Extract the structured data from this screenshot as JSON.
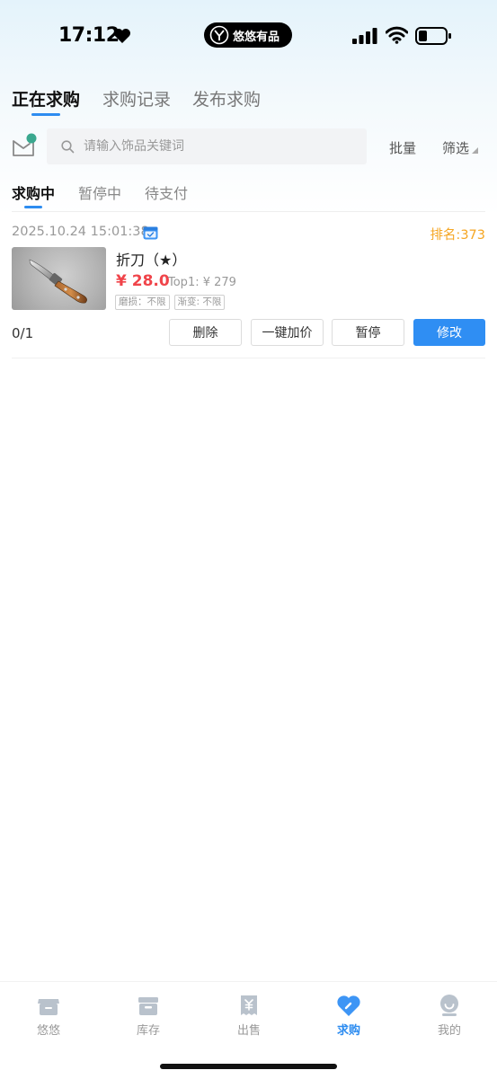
{
  "status_bar": {
    "time": "17:12",
    "app_pill": "悠悠有品"
  },
  "main_tabs": [
    {
      "label": "正在求购",
      "active": true
    },
    {
      "label": "求购记录",
      "active": false
    },
    {
      "label": "发布求购",
      "active": false
    }
  ],
  "search": {
    "placeholder": "请输入饰品关键词",
    "value": ""
  },
  "toolbar": {
    "batch_label": "批量",
    "filter_label": "筛选"
  },
  "sub_tabs": [
    {
      "label": "求购中",
      "active": true
    },
    {
      "label": "暂停中",
      "active": false
    },
    {
      "label": "待支付",
      "active": false
    }
  ],
  "orders": [
    {
      "date": "2025.10.24 15:01:38",
      "rank": "排名:373",
      "name": "折刀（★）",
      "price": "¥ 28.0",
      "top_price": "Top1: ¥ 279",
      "tags": [
        "磨损：不限",
        "渐变: 不限"
      ],
      "progress": "0/1",
      "actions": {
        "delete": "删除",
        "raise": "一键加价",
        "pause": "暂停",
        "edit": "修改"
      }
    }
  ],
  "bottom_nav": [
    {
      "label": "悠悠",
      "icon": "shop-icon",
      "active": false
    },
    {
      "label": "库存",
      "icon": "box-icon",
      "active": false
    },
    {
      "label": "出售",
      "icon": "receipt-icon",
      "active": false
    },
    {
      "label": "求购",
      "icon": "heart-tag-icon",
      "active": true
    },
    {
      "label": "我的",
      "icon": "profile-icon",
      "active": false
    }
  ],
  "colors": {
    "accent": "#2d8cf0",
    "price": "#f0444a",
    "rank": "#f5a623",
    "unread_dot": "#3aa88f"
  }
}
